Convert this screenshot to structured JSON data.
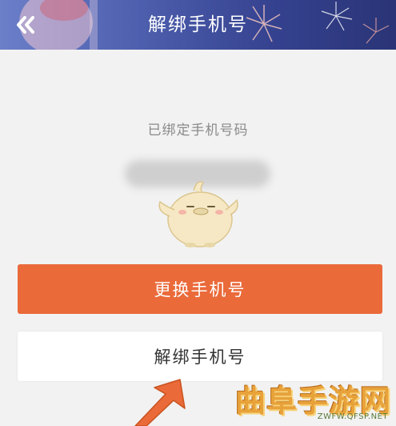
{
  "header": {
    "title": "解绑手机号",
    "back_icon": "double-chevron-left-icon",
    "background_colors": [
      "#6b7fc9",
      "#34418e"
    ]
  },
  "main": {
    "subtitle": "已绑定手机号码",
    "primary_button_label": "更换手机号",
    "primary_button_color": "#ea6a3a",
    "secondary_button_label": "解绑手机号"
  },
  "watermark": {
    "logo_text": "曲阜手游网",
    "url": "ZWFW.QFSP.NET"
  },
  "icons": {
    "mascot": "chick-mascot-icon",
    "pointer": "pointer-arrow-icon"
  }
}
